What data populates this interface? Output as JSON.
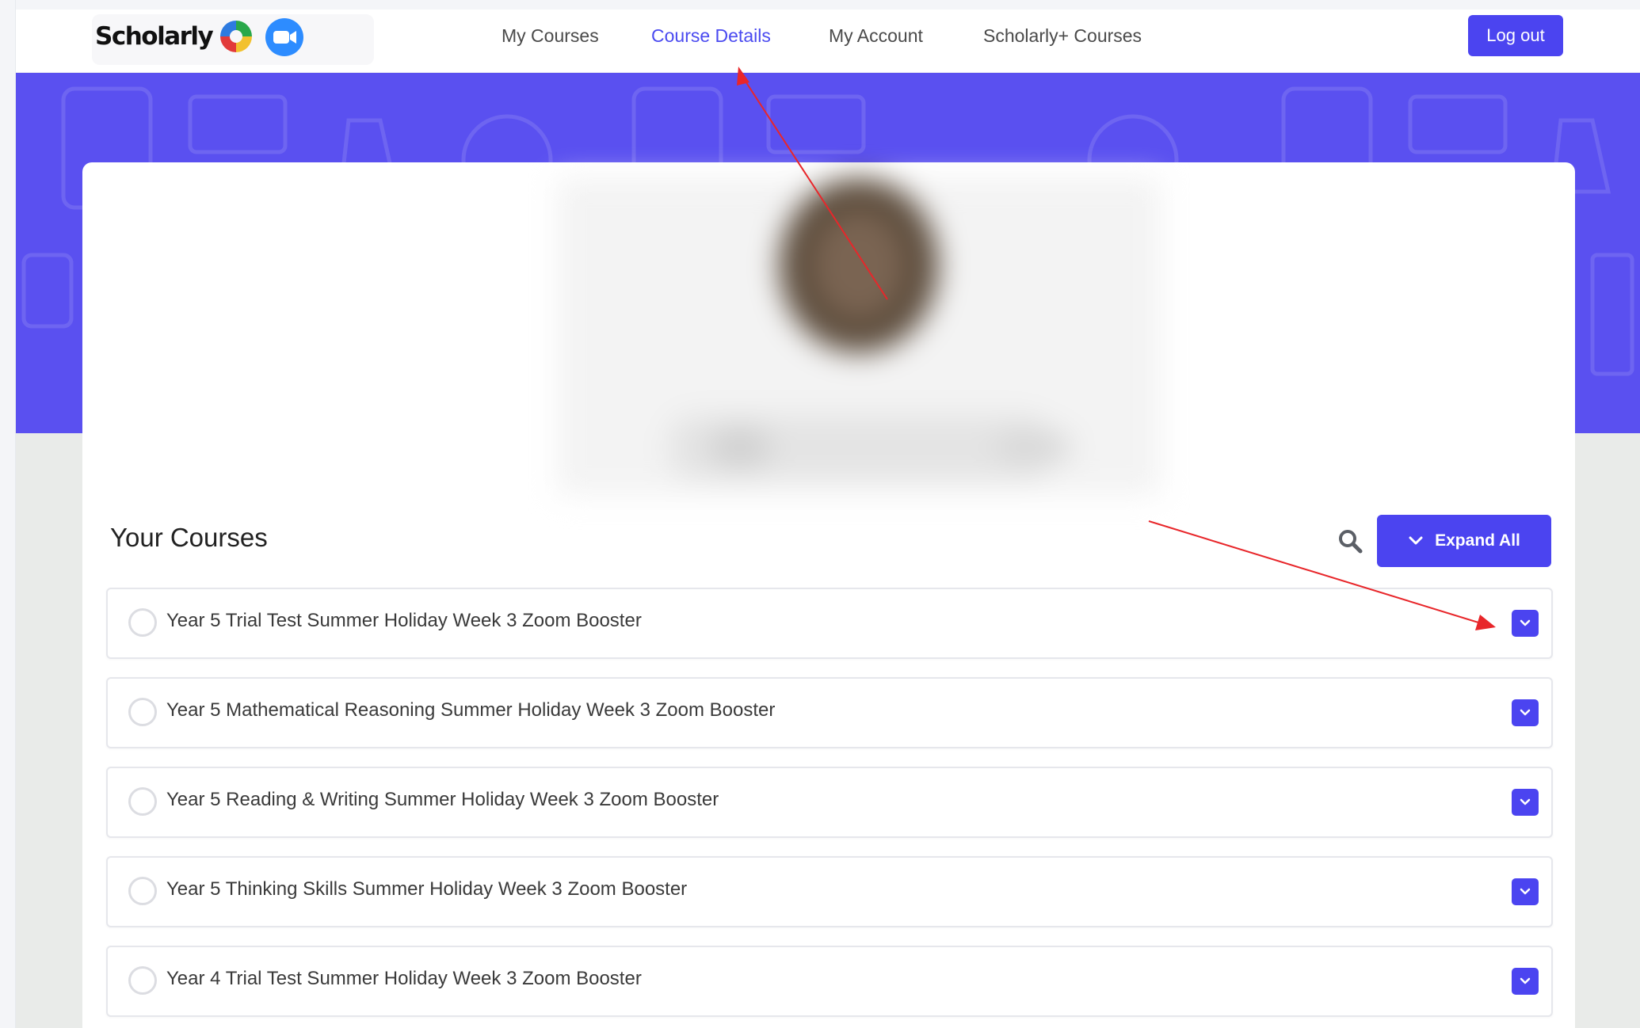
{
  "header": {
    "logo_text": "Scholarly",
    "nav": [
      {
        "label": "My Courses",
        "active": false
      },
      {
        "label": "Course Details",
        "active": true
      },
      {
        "label": "My Account",
        "active": false
      },
      {
        "label": "Scholarly+ Courses",
        "active": false
      }
    ],
    "logout_label": "Log out"
  },
  "main": {
    "section_title": "Your Courses",
    "expand_all_label": "Expand All",
    "courses": [
      {
        "title": "Year 5 Trial Test Summer Holiday Week 3 Zoom Booster"
      },
      {
        "title": "Year 5 Mathematical Reasoning Summer Holiday Week 3 Zoom Booster"
      },
      {
        "title": "Year 5 Reading & Writing Summer Holiday Week 3 Zoom Booster"
      },
      {
        "title": "Year 5 Thinking Skills Summer Holiday Week 3 Zoom Booster"
      },
      {
        "title": "Year 4 Trial Test Summer Holiday Week 3 Zoom Booster"
      }
    ]
  },
  "colors": {
    "accent": "#4b44f0",
    "banner": "#5a50f0",
    "annotation_arrow": "#e8262a"
  },
  "icons": {
    "logo_mark": "scholarly-four-color-ring",
    "zoom": "zoom-video-camera-icon",
    "search": "magnifier-icon",
    "expand": "chevron-down-icon",
    "course_toggle": "chevron-down-icon",
    "course_status": "empty-circle-icon"
  }
}
